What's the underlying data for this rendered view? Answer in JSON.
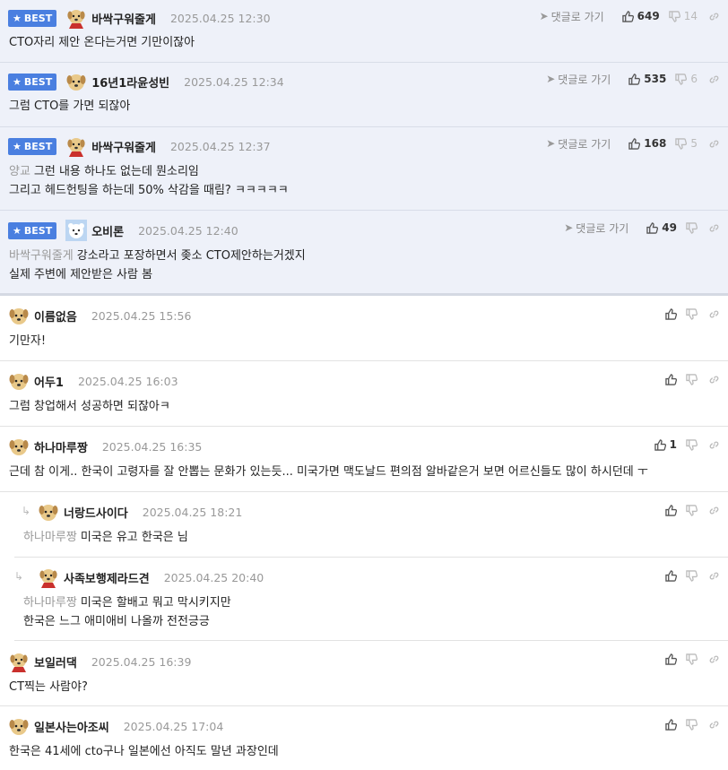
{
  "actions": {
    "reply_label": "댓글로 가기",
    "best_label": "BEST"
  },
  "comments": [
    {
      "nick": "바싹구워줄게",
      "date": "2025.04.25 12:30",
      "up": "649",
      "down": "14",
      "lines": [
        "CTO자리 제안 온다는거면 기만이잖아"
      ]
    },
    {
      "nick": "16년1라윤성빈",
      "date": "2025.04.25 12:34",
      "up": "535",
      "down": "6",
      "lines": [
        "그럼 CTO를 가면 되잖아"
      ]
    },
    {
      "nick": "바싹구워줄게",
      "date": "2025.04.25 12:37",
      "up": "168",
      "down": "5",
      "mention": "양교",
      "lines": [
        "그런 내용 하나도 없는데 뭔소리임",
        "그리고 헤드헌팅을 하는데 50% 삭감을 때림? ㅋㅋㅋㅋㅋ"
      ]
    },
    {
      "nick": "오비론",
      "date": "2025.04.25 12:40",
      "up": "49",
      "down": "",
      "mention": "바싹구워줄게",
      "lines": [
        "강소라고 포장하면서 좆소 CTO제안하는거겠지",
        "실제 주변에 제안받은 사람 봄"
      ]
    },
    {
      "nick": "이름없음",
      "date": "2025.04.25 15:56",
      "lines": [
        "기만자!"
      ]
    },
    {
      "nick": "어두1",
      "date": "2025.04.25 16:03",
      "lines": [
        "그럼 창업해서 성공하면 되잖아ㅋ"
      ]
    },
    {
      "nick": "하나마루짱",
      "date": "2025.04.25 16:35",
      "up": "1",
      "lines": [
        "근데 참 이게.. 한국이 고령자를 잘 안뽑는 문화가 있는듯... 미국가면 맥도날드 편의점 알바같은거 보면 어르신들도 많이 하시던데 ㅜ"
      ]
    },
    {
      "nick": "너랑드사이다",
      "date": "2025.04.25 18:21",
      "mention": "하나마루짱",
      "lines": [
        "미국은 유고 한국은 님"
      ]
    },
    {
      "nick": "사족보행제라드견",
      "date": "2025.04.25 20:40",
      "mention": "하나마루짱",
      "lines": [
        "미국은 할배고 뭐고 막시키지만",
        "한국은 느그 애미애비 나올까 전전긍긍"
      ]
    },
    {
      "nick": "보일러댁",
      "date": "2025.04.25 16:39",
      "lines": [
        "CT찍는 사람야?"
      ]
    },
    {
      "nick": "일본사는아조씨",
      "date": "2025.04.25 17:04",
      "lines": [
        "한국은 41세에 cto구나 일본에선 아직도 말년 과장인데"
      ]
    }
  ]
}
